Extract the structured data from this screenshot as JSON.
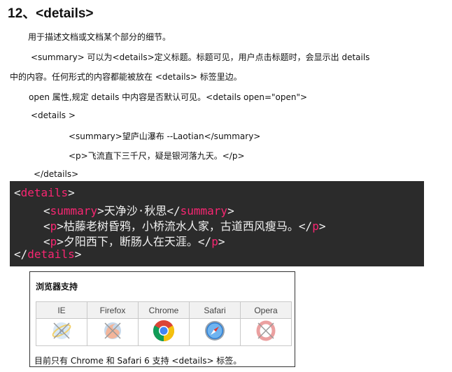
{
  "heading": "12、<details>",
  "paragraphs": [
    "用于描述文档或文档某个部分的细节。",
    "<summary> 可以为<details>定义标题。标题可见，用户点击标题时，会显示出 details",
    "中的内容。任何形式的内容都能被放在 <details> 标签里边。",
    "open 属性,规定 details 中内容是否默认可见。<details open=\"open\">",
    "<details >",
    "<summary>望庐山瀑布 --Laotian</summary>",
    "<p>飞流直下三千尺，疑是银河落九天。</p>",
    "</details>"
  ],
  "code_block": {
    "line1": {
      "open": "<",
      "tag": "details",
      "close": ">"
    },
    "line2": {
      "open": "<",
      "tag": "summary",
      "text": ">天净沙·秋思</",
      "tag2": "summary",
      "close": ">"
    },
    "line3": {
      "open": "<",
      "tag": "p",
      "text": ">枯藤老树昏鸦，小桥流水人家，古道西风瘦马。</",
      "tag2": "p",
      "close": ">"
    },
    "line4": {
      "open": "<",
      "tag": "p",
      "text": ">夕阳西下，断肠人在天涯。</",
      "tag2": "p",
      "close": ">"
    },
    "line5": {
      "open": "</",
      "tag": "details",
      "close": ">"
    }
  },
  "browser_support": {
    "title": "浏览器支持",
    "browsers": [
      "IE",
      "Firefox",
      "Chrome",
      "Safari",
      "Opera"
    ],
    "note": "目前只有 Chrome 和 Safari 6 支持 <details> 标签。"
  },
  "colors": {
    "code_bg": "#2b2b2b",
    "tag_color": "#f92672"
  }
}
